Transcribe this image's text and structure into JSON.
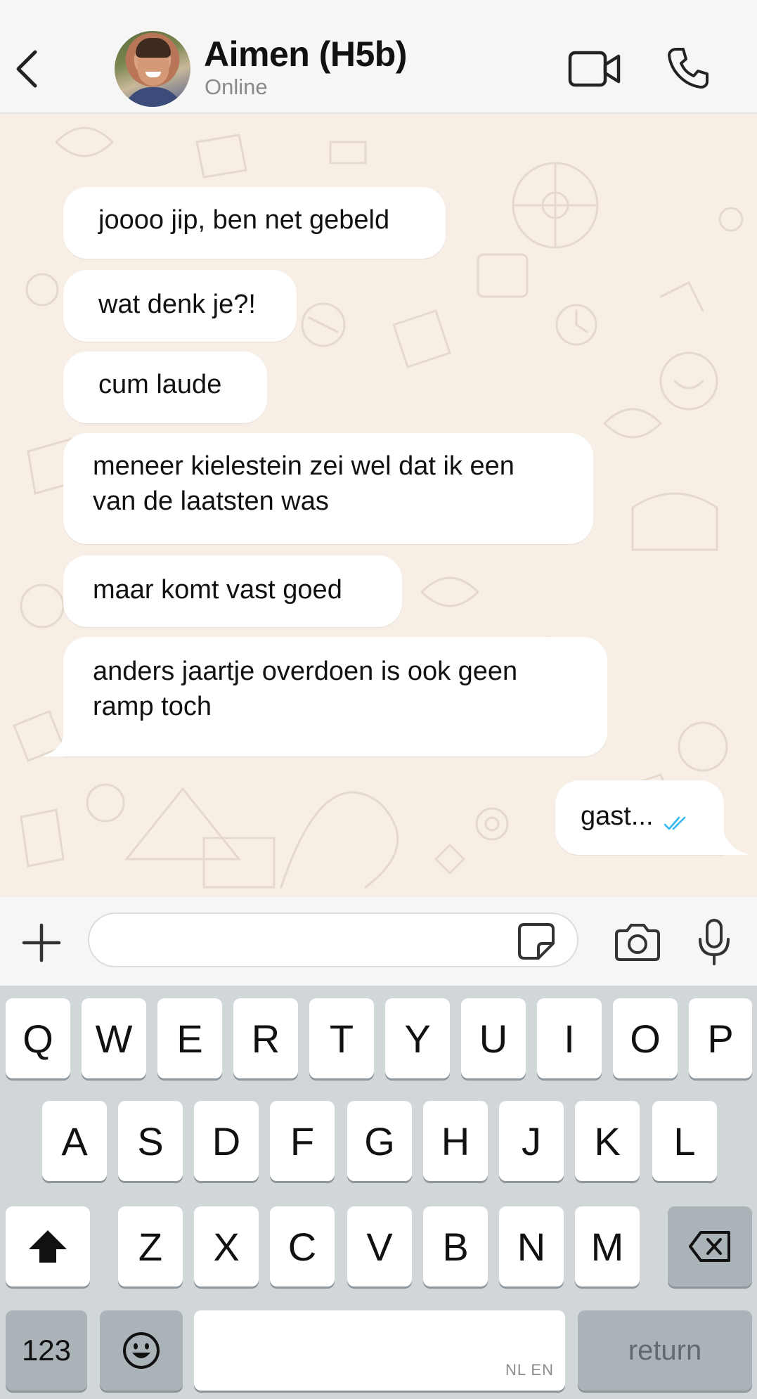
{
  "header": {
    "back_icon": "chevron-left-icon",
    "contact_name": "Aimen (H5b)",
    "status": "Online",
    "video_icon": "video-camera-icon",
    "call_icon": "phone-icon"
  },
  "messages": [
    {
      "direction": "incoming",
      "text": "joooo jip, ben net gebeld"
    },
    {
      "direction": "incoming",
      "text": "wat denk je?!"
    },
    {
      "direction": "incoming",
      "text": "cum laude"
    },
    {
      "direction": "incoming",
      "text_lines": [
        "meneer kielestein zei wel dat ik een",
        "van de laatsten was"
      ]
    },
    {
      "direction": "incoming",
      "text": "maar komt vast goed"
    },
    {
      "direction": "incoming",
      "text_lines": [
        "anders jaartje overdoen is ook geen",
        "ramp toch"
      ]
    },
    {
      "direction": "outgoing",
      "text": "gast...",
      "receipt": "read-double-check-icon",
      "receipt_color": "#34b7f1"
    }
  ],
  "input_bar": {
    "plus_icon": "plus-icon",
    "placeholder": "",
    "value": "",
    "sticker_icon": "sticker-icon",
    "camera_icon": "camera-icon",
    "mic_icon": "microphone-icon"
  },
  "keyboard": {
    "row1": [
      "Q",
      "W",
      "E",
      "R",
      "T",
      "Y",
      "U",
      "I",
      "O",
      "P"
    ],
    "row2": [
      "A",
      "S",
      "D",
      "F",
      "G",
      "H",
      "J",
      "K",
      "L"
    ],
    "row3": [
      "Z",
      "X",
      "C",
      "V",
      "B",
      "N",
      "M"
    ],
    "shift_icon": "shift-arrow-icon",
    "backspace_icon": "backspace-icon",
    "numbers_label": "123",
    "emoji_icon": "emoji-smiley-icon",
    "space_hint": "NL EN",
    "return_label": "return"
  },
  "colors": {
    "chat_background": "#f7efe5",
    "bubble": "#ffffff",
    "read_receipt": "#34b7f1",
    "keyboard_background": "#d1d6d9"
  }
}
